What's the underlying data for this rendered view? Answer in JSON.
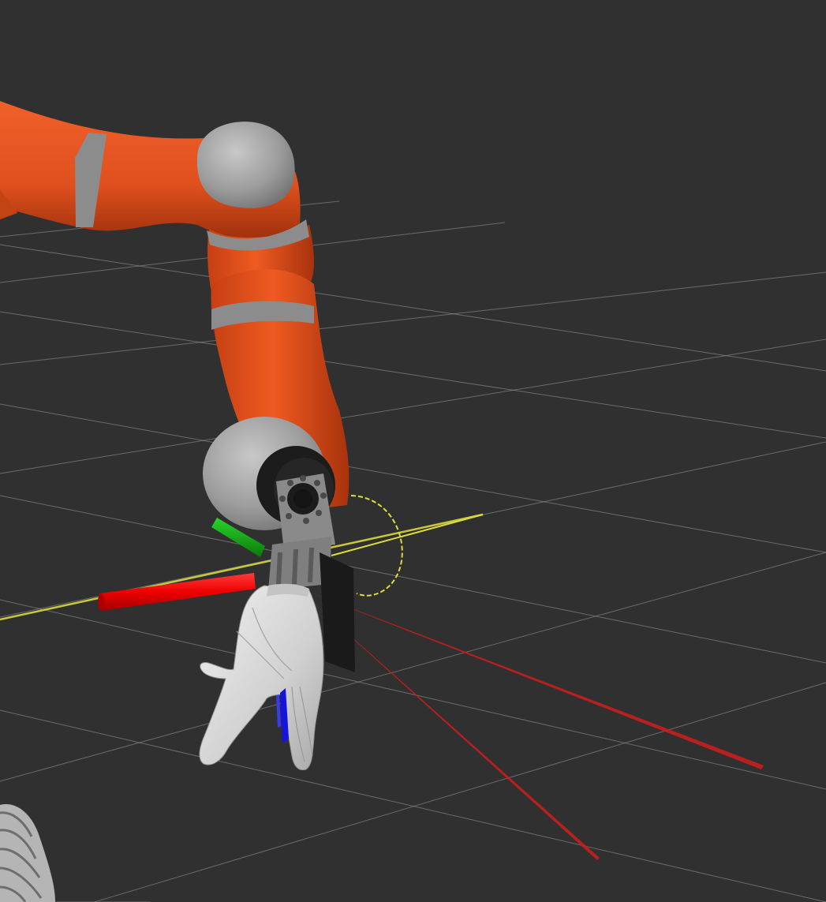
{
  "scene": {
    "background_color": "#303030",
    "grid_color": "#9a9a9a",
    "robot_arm": {
      "link_color": "#e0501e",
      "joint_color": "#9a9a9a",
      "ring_color": "#8c8c8c"
    },
    "flange": {
      "plate_color": "#8a8a8a",
      "bracket_color": "#7f7f7f",
      "bore_color": "#1c1c1c"
    },
    "pad_color": "#1a1a1a",
    "hand": {
      "skin_color": "#dedede",
      "shadow_color": "#9a9a9a",
      "marker_color": "#1414dd"
    },
    "axes": {
      "x_color": "#ff0000",
      "y_color": "#00c400"
    },
    "guide_line_color": "#c8c83c",
    "rotation_ring_color": "#dcdc3c",
    "ray_color": "#c81e1e",
    "gear_color": "#b5b5b5"
  }
}
